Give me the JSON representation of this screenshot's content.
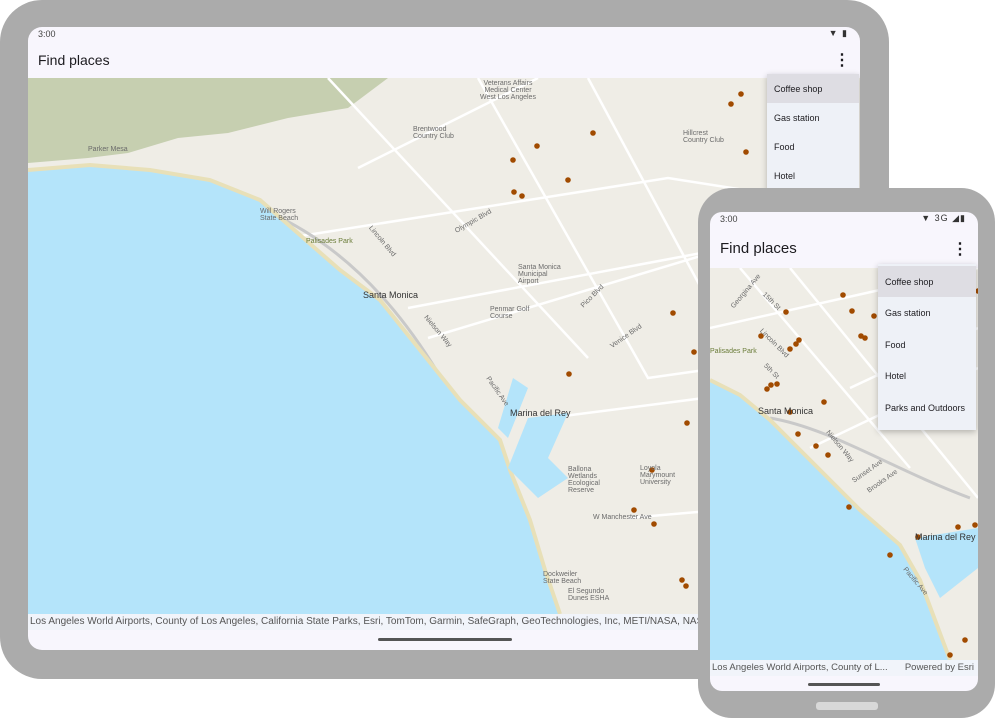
{
  "tablet": {
    "status": {
      "time": "3:00",
      "icons": "wifi-icon battery-icon"
    },
    "app_title": "Find places",
    "menu": [
      "Coffee shop",
      "Gas station",
      "Food",
      "Hotel"
    ],
    "selected": "Coffee shop",
    "attribution": "Los Angeles World Airports, County of Los Angeles, California State Parks, Esri, TomTom, Garmin, SafeGraph, GeoTechnologies, Inc, METI/NASA, NASA, NGA, USGS",
    "map_labels": [
      "Santa Monica",
      "Marina del Rey",
      "Will Rogers State Beach",
      "Palisades Park",
      "Parker Mesa",
      "Brentwood Country Club",
      "Santa Monica Municipal Airport",
      "Penmar Golf Course",
      "Ballona Wetlands Ecological Reserve",
      "Loyola Marymount University",
      "Dockweiler State Beach",
      "El Segundo Dunes ESHA",
      "Hillcrest Country Club",
      "Veterans Affairs Medical Center West Los Angeles",
      "Olympic Blvd",
      "Lincoln Blvd",
      "Pico Blvd",
      "Venice Blvd",
      "W Manchester Ave",
      "Pacific Ave",
      "Nielson Way"
    ]
  },
  "phone": {
    "status": {
      "time": "3:00",
      "network": "3G"
    },
    "app_title": "Find places",
    "menu": [
      "Coffee shop",
      "Gas station",
      "Food",
      "Hotel",
      "Parks and Outdoors"
    ],
    "selected": "Coffee shop",
    "attribution": "Los Angeles World Airports, County of L...",
    "powered_by": "Powered by Esri",
    "map_labels": [
      "Santa Monica",
      "Marina del Rey",
      "Palisades Park",
      "15th St",
      "Lincoln Blvd",
      "5th St",
      "Sunset Ave",
      "Brooks Ave",
      "Pacific Ave",
      "Nielson Way",
      "Georgina Ave"
    ]
  },
  "colors": {
    "water": "#b4e4fa",
    "land": "#efede6",
    "poi": "#a14b00",
    "hills": "#c6cfb0",
    "menu_selected": "#dedde3"
  }
}
